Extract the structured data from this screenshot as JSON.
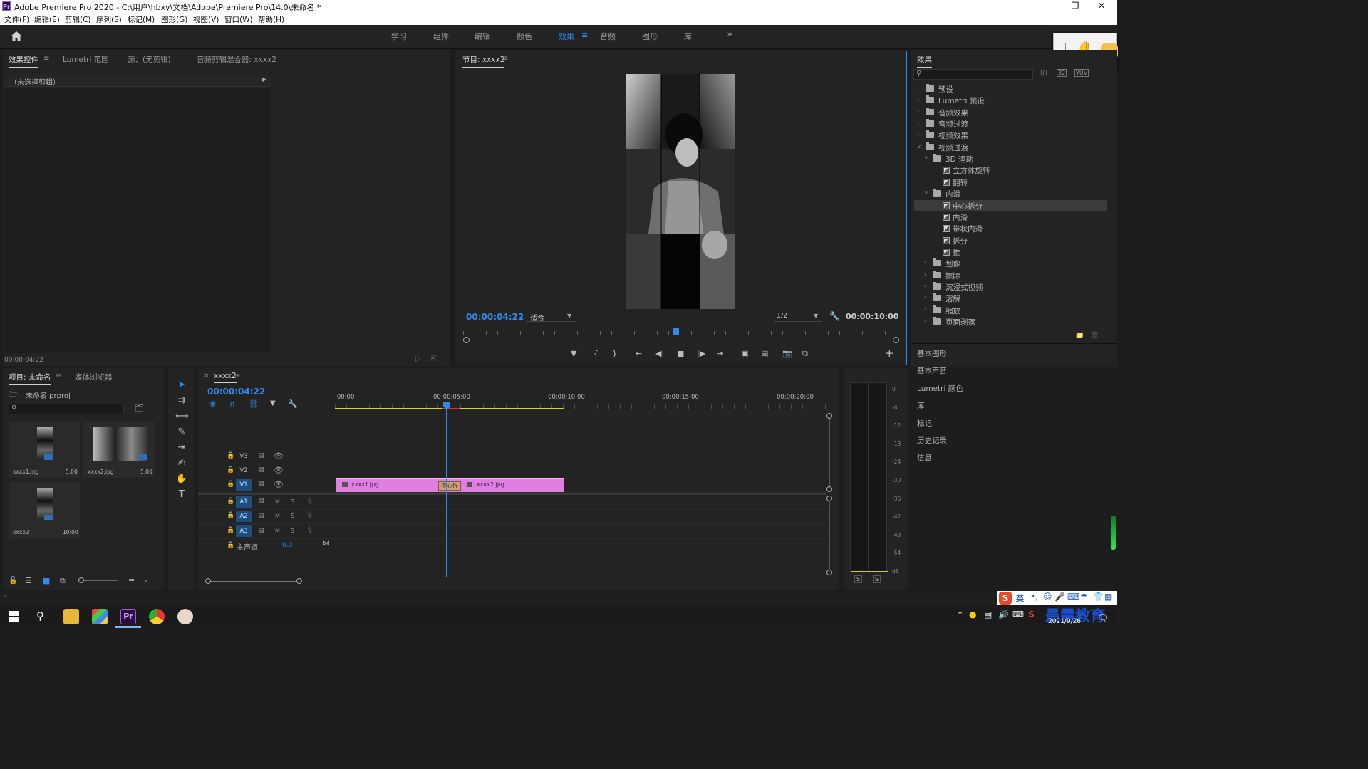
{
  "window": {
    "title": "Adobe Premiere Pro 2020 - C:\\用户\\hbxy\\文档\\Adobe\\Premiere Pro\\14.0\\未命名 *",
    "logo": "Pr"
  },
  "menu": [
    "文件(F)",
    "编辑(E)",
    "剪辑(C)",
    "序列(S)",
    "标记(M)",
    "图形(G)",
    "视图(V)",
    "窗口(W)",
    "帮助(H)"
  ],
  "workspaces": [
    "学习",
    "组件",
    "编辑",
    "颜色",
    "效果",
    "音频",
    "图形",
    "库"
  ],
  "active_workspace": "效果",
  "source_panel": {
    "tabs": [
      "效果控件",
      "Lumetri 范围",
      "源：(无剪辑)",
      "音频剪辑混合器: xxxx2"
    ],
    "no_clip": "（未选择剪辑）",
    "timecode": "00:00:04:22"
  },
  "program_monitor": {
    "tab": "节目: xxxx2",
    "timecode": "00:00:04:22",
    "fit": "适合",
    "resolution": "1/2",
    "duration": "00:00:10:00",
    "playhead_fraction": 0.49
  },
  "effects_panel": {
    "title": "效果",
    "tree": [
      {
        "label": "预设",
        "level": 0,
        "type": "preset-folder",
        "expanded": false
      },
      {
        "label": "Lumetri 预设",
        "level": 0,
        "type": "preset-folder",
        "expanded": false
      },
      {
        "label": "音频效果",
        "level": 0,
        "type": "folder",
        "expanded": false
      },
      {
        "label": "音频过渡",
        "level": 0,
        "type": "folder",
        "expanded": false
      },
      {
        "label": "视频效果",
        "level": 0,
        "type": "folder",
        "expanded": false
      },
      {
        "label": "视频过渡",
        "level": 0,
        "type": "folder",
        "expanded": true
      },
      {
        "label": "3D 运动",
        "level": 1,
        "type": "folder",
        "expanded": true
      },
      {
        "label": "立方体旋转",
        "level": 2,
        "type": "effect"
      },
      {
        "label": "翻转",
        "level": 2,
        "type": "effect"
      },
      {
        "label": "内滑",
        "level": 1,
        "type": "folder",
        "expanded": true
      },
      {
        "label": "中心拆分",
        "level": 2,
        "type": "effect",
        "selected": true
      },
      {
        "label": "内滑",
        "level": 2,
        "type": "effect"
      },
      {
        "label": "带状内滑",
        "level": 2,
        "type": "effect"
      },
      {
        "label": "拆分",
        "level": 2,
        "type": "effect"
      },
      {
        "label": "推",
        "level": 2,
        "type": "effect"
      },
      {
        "label": "划像",
        "level": 1,
        "type": "folder",
        "expanded": false
      },
      {
        "label": "擦除",
        "level": 1,
        "type": "folder",
        "expanded": false
      },
      {
        "label": "沉浸式视频",
        "level": 1,
        "type": "folder",
        "expanded": false
      },
      {
        "label": "溶解",
        "level": 1,
        "type": "folder",
        "expanded": false
      },
      {
        "label": "缩放",
        "level": 1,
        "type": "folder",
        "expanded": false
      },
      {
        "label": "页面剥落",
        "level": 1,
        "type": "folder",
        "expanded": false
      }
    ],
    "side_panels": [
      "基本图形",
      "基本声音",
      "Lumetri 颜色",
      "库",
      "标记",
      "历史记录",
      "信息"
    ]
  },
  "project_panel": {
    "tabs": [
      "项目: 未命名",
      "媒体浏览器"
    ],
    "file": "未命名.prproj",
    "items": [
      {
        "name": "xxxx1.jpg",
        "duration": "5:00"
      },
      {
        "name": "xxxx2.jpg",
        "duration": "5:00"
      },
      {
        "name": "xxxx2",
        "duration": "10:00"
      }
    ]
  },
  "timeline": {
    "tab": "xxxx2",
    "timecode": "00:00:04:22",
    "ruler": [
      ":00:00",
      "00:00:05:00",
      "00:00:10:00",
      "00:00:15:00",
      "00:00:20:00"
    ],
    "tracks": [
      "V3",
      "V2",
      "V1",
      "A1",
      "A2",
      "A3"
    ],
    "master_label": "主声道",
    "master_value": "0.0",
    "clips": [
      {
        "name": "xxxx1.jpg"
      },
      {
        "name": "xxxx2.jpg"
      }
    ],
    "transition_label": "中心拆",
    "mute_label": "M",
    "solo_label": "S"
  },
  "audio_meter": {
    "scale": [
      "0",
      "-6",
      "-12",
      "-18",
      "-24",
      "-30",
      "-36",
      "-42",
      "-48",
      "-54",
      "dB"
    ],
    "solo_labels": [
      "S",
      "S"
    ]
  },
  "taskbar": {
    "date": "2021/9/26",
    "ime": "英",
    "watermark": "最需教育"
  },
  "colors": {
    "accent_blue": "#2d8ceb",
    "clip_pink": "#e17ee1",
    "work_area_yellow": "#d8d816",
    "track_target": "#1c4e80"
  }
}
